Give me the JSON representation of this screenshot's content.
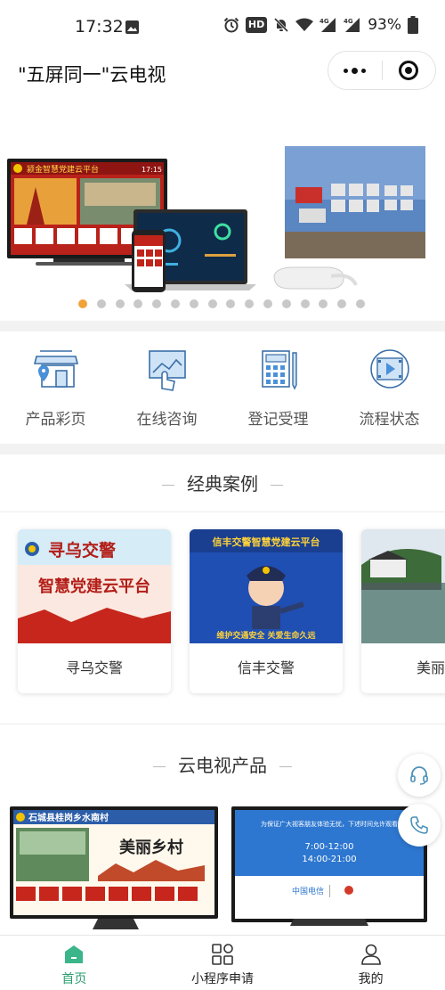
{
  "status_bar": {
    "time": "17:32",
    "hd_label": "HD",
    "battery": "93%"
  },
  "header": {
    "title": "\"五屏同一\"云电视"
  },
  "banner": {
    "screen_title": "颍金智慧党建云平台",
    "screen_time": "17:15",
    "page_count": 16,
    "active_index": 0
  },
  "quick_menu": [
    {
      "label": "产品彩页",
      "icon": "storefront-pin-icon"
    },
    {
      "label": "在线咨询",
      "icon": "touch-screen-icon"
    },
    {
      "label": "登记受理",
      "icon": "calculator-ruler-icon"
    },
    {
      "label": "流程状态",
      "icon": "play-film-icon"
    }
  ],
  "cases": {
    "title": "经典案例",
    "items": [
      {
        "label": "寻乌交警",
        "img_line1": "寻乌交警",
        "img_line2": "智慧党建云平台"
      },
      {
        "label": "信丰交警",
        "img_line1": "信丰交警智慧党建云平台",
        "img_line2": "维护交通安全 关爱生命久远"
      },
      {
        "label": "美丽乡",
        "img_line1": "",
        "img_line2": ""
      }
    ]
  },
  "products": {
    "title": "云电视产品",
    "items": [
      {
        "img_title": "石城县桂岗乡水南村",
        "img_main": "美丽乡村"
      },
      {
        "img_title": "为保证广大视客朋友体验无忧，下述时间允许观看",
        "img_time1": "7:00-12:00",
        "img_time2": "14:00-21:00",
        "img_brand": "中国电信"
      }
    ]
  },
  "tabbar": [
    {
      "label": "首页",
      "active": true
    },
    {
      "label": "小程序申请",
      "active": false
    },
    {
      "label": "我的",
      "active": false
    }
  ],
  "colors": {
    "accent": "#2a9d6e",
    "pager_active": "#f2a23a",
    "party_red": "#d42a1c"
  }
}
